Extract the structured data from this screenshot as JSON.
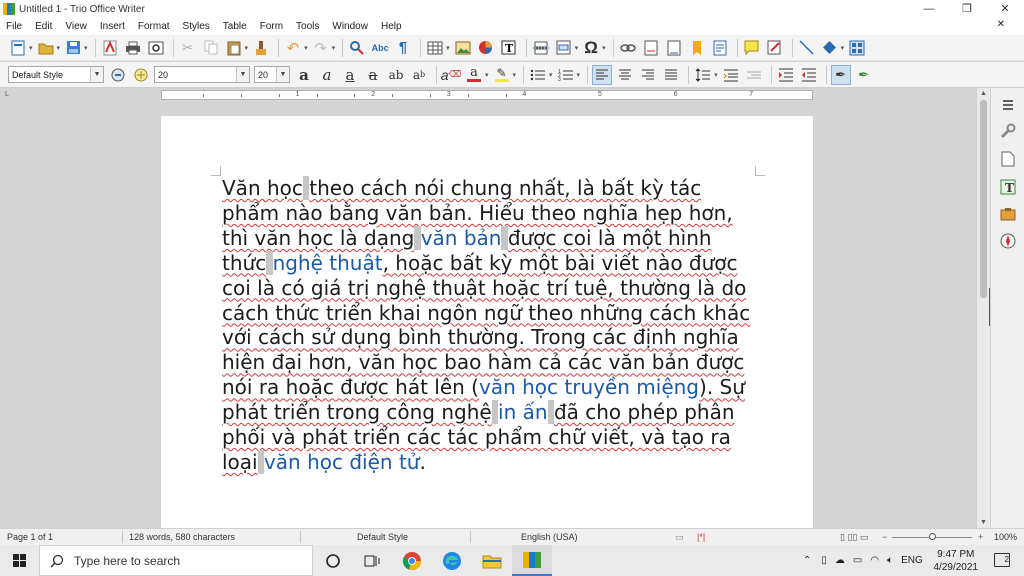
{
  "window": {
    "title": "Untitled 1 - Trio Office Writer",
    "controls": {
      "minimize": "—",
      "restore": "❐",
      "close": "✕"
    }
  },
  "menu": [
    "File",
    "Edit",
    "View",
    "Insert",
    "Format",
    "Styles",
    "Table",
    "Form",
    "Tools",
    "Window",
    "Help"
  ],
  "menu_close": "✕",
  "formatting": {
    "paragraph_style": "Default Style",
    "font_name": "20",
    "font_size": "20"
  },
  "ruler": {
    "numbers": [
      "1",
      "2",
      "3",
      "4",
      "5",
      "6",
      "7"
    ]
  },
  "document": {
    "segments": [
      {
        "t": "Văn học",
        "s": "w"
      },
      {
        "t": " ",
        "s": "hl"
      },
      {
        "t": "theo cách nói chung nhất, là bất kỳ tác phẩm nào bằng văn bản. Hiểu theo nghĩa hẹp hơn, thì văn học là dạng",
        "s": "w"
      },
      {
        "t": " ",
        "s": "hl"
      },
      {
        "t": "văn bản",
        "s": "link"
      },
      {
        "t": " ",
        "s": "hl"
      },
      {
        "t": "được coi là một hình thức",
        "s": "w"
      },
      {
        "t": " ",
        "s": "hl"
      },
      {
        "t": "nghệ thuật",
        "s": "link"
      },
      {
        "t": ", hoặc bất kỳ một bài viết nào được coi là có giá trị nghệ thuật hoặc trí tuệ, thường là do cách thức triển khai ngôn ngữ theo những cách khác với cách sử dụng bình thường. Trong các định nghĩa hiện đại hơn, văn học bao hàm cả các văn bản được nói ra hoặc được hát lên (",
        "s": "w"
      },
      {
        "t": "văn học truyền miệng",
        "s": "link"
      },
      {
        "t": "). Sự phát triển trong công nghệ",
        "s": "w"
      },
      {
        "t": " ",
        "s": "hl"
      },
      {
        "t": "in ấn",
        "s": "link"
      },
      {
        "t": " ",
        "s": "hl"
      },
      {
        "t": "đã cho phép phân phối và phát triển các tác phẩm chữ viết, và tạo ra loại",
        "s": "w"
      },
      {
        "t": " ",
        "s": "hl"
      },
      {
        "t": "văn học điện tử",
        "s": "link"
      },
      {
        "t": ".",
        "s": "plain"
      }
    ]
  },
  "statusbar": {
    "page": "Page 1 of 1",
    "words": "128 words, 580 characters",
    "style": "Default Style",
    "language": "English (USA)",
    "zoom": "100%"
  },
  "taskbar": {
    "search_placeholder": "Type here to search",
    "time": "9:47 PM",
    "date": "4/29/2021",
    "lang": "ENG",
    "notifications": "2"
  },
  "colors": {
    "link": "#1c5aa8",
    "accent": "#3b78d8"
  }
}
